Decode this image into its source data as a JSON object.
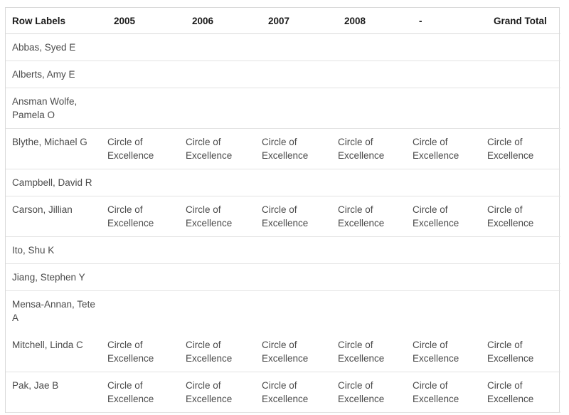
{
  "table": {
    "name": "pivot-table",
    "columns": [
      {
        "key": "row_labels",
        "label": "Row Labels"
      },
      {
        "key": "y2005",
        "label": "2005"
      },
      {
        "key": "y2006",
        "label": "2006"
      },
      {
        "key": "y2007",
        "label": "2007"
      },
      {
        "key": "y2008",
        "label": "2008"
      },
      {
        "key": "blank",
        "label": "-"
      },
      {
        "key": "grand_total",
        "label": "Grand Total"
      }
    ],
    "rows": [
      {
        "row_labels": "Abbas, Syed E",
        "y2005": "",
        "y2006": "",
        "y2007": "",
        "y2008": "",
        "blank": "",
        "grand_total": ""
      },
      {
        "row_labels": "Alberts, Amy E",
        "y2005": "",
        "y2006": "",
        "y2007": "",
        "y2008": "",
        "blank": "",
        "grand_total": ""
      },
      {
        "row_labels": "Ansman Wolfe, Pamela O",
        "y2005": "",
        "y2006": "",
        "y2007": "",
        "y2008": "",
        "blank": "",
        "grand_total": ""
      },
      {
        "row_labels": "Blythe, Michael G",
        "y2005": "Circle of Excellence",
        "y2006": "Circle of Excellence",
        "y2007": "Circle of Excellence",
        "y2008": "Circle of Excellence",
        "blank": "Circle of Excellence",
        "grand_total": "Circle of Excellence"
      },
      {
        "row_labels": "Campbell, David R",
        "y2005": "",
        "y2006": "",
        "y2007": "",
        "y2008": "",
        "blank": "",
        "grand_total": ""
      },
      {
        "row_labels": "Carson, Jillian",
        "y2005": "Circle of Excellence",
        "y2006": "Circle of Excellence",
        "y2007": "Circle of Excellence",
        "y2008": "Circle of Excellence",
        "blank": "Circle of Excellence",
        "grand_total": "Circle of Excellence"
      },
      {
        "row_labels": "Ito, Shu K",
        "y2005": "",
        "y2006": "",
        "y2007": "",
        "y2008": "",
        "blank": "",
        "grand_total": ""
      },
      {
        "row_labels": "Jiang, Stephen Y",
        "y2005": "",
        "y2006": "",
        "y2007": "",
        "y2008": "",
        "blank": "",
        "grand_total": ""
      },
      {
        "row_labels": "Mensa-Annan, Tete A",
        "y2005": "",
        "y2006": "",
        "y2007": "",
        "y2008": "",
        "blank": "",
        "grand_total": ""
      },
      {
        "row_labels": "Mitchell, Linda C",
        "y2005": "Circle of Excellence",
        "y2006": "Circle of Excellence",
        "y2007": "Circle of Excellence",
        "y2008": "Circle of Excellence",
        "blank": "Circle of Excellence",
        "grand_total": "Circle of Excellence"
      },
      {
        "row_labels": "Pak, Jae B",
        "y2005": "Circle of Excellence",
        "y2006": "Circle of Excellence",
        "y2007": "Circle of Excellence",
        "y2008": "Circle of Excellence",
        "blank": "Circle of Excellence",
        "grand_total": "Circle of Excellence"
      }
    ]
  },
  "colors": {
    "header_text": "#1a1a1a",
    "body_text": "#4a4a4a",
    "border": "#d9d9d9",
    "row_border": "#e3e3e3",
    "background": "#ffffff"
  }
}
